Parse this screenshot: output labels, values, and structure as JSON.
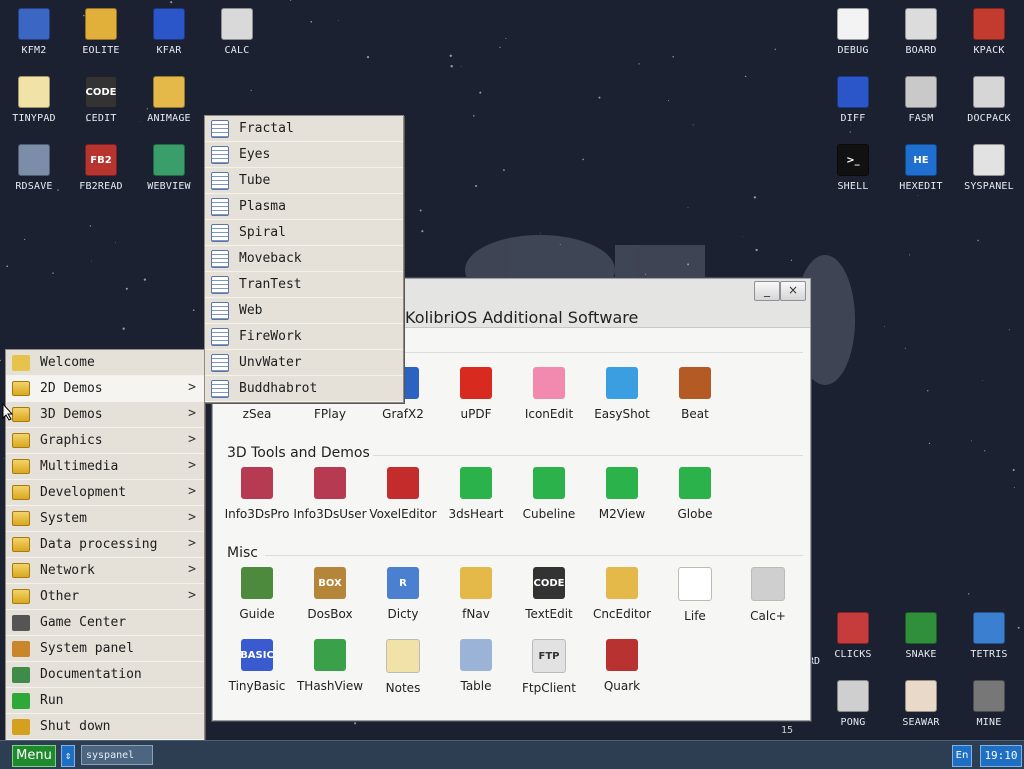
{
  "desktop": {
    "left_icons": [
      {
        "label": "KFM2",
        "color": "#3b66c4",
        "glyph": "floppy-icon"
      },
      {
        "label": "EOLITE",
        "color": "#e0b03a",
        "glyph": "folder-icon"
      },
      {
        "label": "KFAR",
        "color": "#2a56c9",
        "glyph": "kfar-icon"
      },
      {
        "label": "CALC",
        "color": "#d9d9d9",
        "glyph": "calculator-icon"
      },
      {
        "label": "TINYPAD",
        "color": "#f1e2a8",
        "glyph": "notepad-icon"
      },
      {
        "label": "CEDIT",
        "color": "#333333",
        "glyph": "code-icon",
        "text": "CODE"
      },
      {
        "label": "ANIMAGE",
        "color": "#e5b84a",
        "glyph": "pencil-icon"
      },
      {
        "label": "RDSAVE",
        "color": "#7b8da8",
        "glyph": "disk-save-icon"
      },
      {
        "label": "FB2READ",
        "color": "#b8342e",
        "glyph": "book-icon",
        "text": "FB2"
      },
      {
        "label": "WEBVIEW",
        "color": "#3a9e6a",
        "glyph": "globe-map-icon"
      }
    ],
    "right_icons": [
      {
        "label": "DEBUG",
        "color": "#f3f3f3",
        "glyph": "bug-icon"
      },
      {
        "label": "BOARD",
        "color": "#dcdcdc",
        "glyph": "board-icon"
      },
      {
        "label": "KPACK",
        "color": "#c33a2e",
        "glyph": "hammer-icon"
      },
      {
        "label": "DIFF",
        "color": "#2a56c9",
        "glyph": "diff-icon"
      },
      {
        "label": "FASM",
        "color": "#c9c9c9",
        "glyph": "anvil-icon"
      },
      {
        "label": "DOCPACK",
        "color": "#d6d6d6",
        "glyph": "cabinet-icon"
      },
      {
        "label": "SHELL",
        "color": "#111111",
        "glyph": "terminal-icon",
        "text": ">_"
      },
      {
        "label": "HEXEDIT",
        "color": "#1e6fd0",
        "glyph": "hex-icon",
        "text": "HE"
      },
      {
        "label": "SYSPANEL",
        "color": "#e2e2e2",
        "glyph": "sliders-icon"
      }
    ],
    "games_icons": [
      {
        "label": "CLICKS",
        "color": "#c63c3c",
        "glyph": "blocks-icon"
      },
      {
        "label": "SNAKE",
        "color": "#2f8f3a",
        "glyph": "snake-icon"
      },
      {
        "label": "TETRIS",
        "color": "#3b7fd0",
        "glyph": "tetris-icon"
      },
      {
        "label": "PONG",
        "color": "#cfcfcf",
        "glyph": "pong-icon"
      },
      {
        "label": "SEAWAR",
        "color": "#e9d9c9",
        "glyph": "ship-icon"
      },
      {
        "label": "MINE",
        "color": "#777777",
        "glyph": "mine-icon"
      }
    ],
    "partial_label": "RD",
    "partial_number": "15"
  },
  "window": {
    "title": "KolibriOS Additional Software",
    "minimize": "_",
    "close": "×",
    "row1": [
      {
        "label": "zSea",
        "color": "#6b8fd4"
      },
      {
        "label": "FPlay",
        "color": "#3a7ad0"
      },
      {
        "label": "GrafX2",
        "color": "#2c62c2"
      },
      {
        "label": "uPDF",
        "color": "#d92a1f"
      },
      {
        "label": "IconEdit",
        "color": "#f28ab0"
      },
      {
        "label": "EasyShot",
        "color": "#3a9ee0"
      },
      {
        "label": "Beat",
        "color": "#b35a25"
      }
    ],
    "section_3d": "3D Tools and Demos",
    "row3d": [
      {
        "label": "Info3DsPro",
        "color": "#b53a52"
      },
      {
        "label": "Info3DsUser",
        "color": "#b53a52"
      },
      {
        "label": "VoxelEditor",
        "color": "#c42c2c"
      },
      {
        "label": "3dsHeart",
        "color": "#2cb24a"
      },
      {
        "label": "Cubeline",
        "color": "#2cb24a"
      },
      {
        "label": "M2View",
        "color": "#2cb24a"
      },
      {
        "label": "Globe",
        "color": "#2cb24a"
      }
    ],
    "section_misc": "Misc",
    "rowmisc1": [
      {
        "label": "Guide",
        "color": "#4d8a3e"
      },
      {
        "label": "DosBox",
        "color": "#b5853a",
        "text": "BOX"
      },
      {
        "label": "Dicty",
        "color": "#4b7fd0",
        "text": "R"
      },
      {
        "label": "fNav",
        "color": "#e5b84a"
      },
      {
        "label": "TextEdit",
        "color": "#333333",
        "text": "CODE"
      },
      {
        "label": "CncEditor",
        "color": "#e5b84a"
      },
      {
        "label": "Life",
        "color": "#ffffff"
      },
      {
        "label": "Calc+",
        "color": "#cfcfcf"
      }
    ],
    "rowmisc2": [
      {
        "label": "TinyBasic",
        "color": "#3a5ad0",
        "text": "BASIC"
      },
      {
        "label": "THashView",
        "color": "#3aa04a"
      },
      {
        "label": "Notes",
        "color": "#f1e2a8"
      },
      {
        "label": "Table",
        "color": "#9ab3d6"
      },
      {
        "label": "FtpClient",
        "color": "#e2e2e2",
        "text": "FTP"
      },
      {
        "label": "Quark",
        "color": "#b83232"
      }
    ]
  },
  "main_menu": [
    {
      "label": "Welcome",
      "kind": "welcome-icon",
      "color": "#e6c34a"
    },
    {
      "label": "2D Demos",
      "kind": "folder",
      "arrow": ">",
      "selected": true
    },
    {
      "label": "3D Demos",
      "kind": "folder",
      "arrow": ">"
    },
    {
      "label": "Graphics",
      "kind": "folder",
      "arrow": ">"
    },
    {
      "label": "Multimedia",
      "kind": "folder",
      "arrow": ">"
    },
    {
      "label": "Development",
      "kind": "folder",
      "arrow": ">"
    },
    {
      "label": "System",
      "kind": "folder",
      "arrow": ">"
    },
    {
      "label": "Data processing",
      "kind": "folder",
      "arrow": ">"
    },
    {
      "label": "Network",
      "kind": "folder",
      "arrow": ">"
    },
    {
      "label": "Other",
      "kind": "folder",
      "arrow": ">"
    },
    {
      "label": "Game Center",
      "kind": "gamepad-icon",
      "color": "#555555"
    },
    {
      "label": "System panel",
      "kind": "gears-icon",
      "color": "#c9862b"
    },
    {
      "label": "Documentation",
      "kind": "books-icon",
      "color": "#3f8c4a"
    },
    {
      "label": "Run",
      "kind": "play-icon",
      "color": "#2fa83a"
    },
    {
      "label": "Shut down",
      "kind": "key-icon",
      "color": "#d4a020"
    }
  ],
  "submenu_2d": [
    "Fractal",
    "Eyes",
    "Tube",
    "Plasma",
    "Spiral",
    "Moveback",
    "TranTest",
    "Web",
    "FireWork",
    "UnvWater",
    "Buddhabrot"
  ],
  "taskbar": {
    "menu_label": "Menu",
    "switch_label": "⇕",
    "task_item": "syspanel",
    "lang": "En",
    "clock": "19:10"
  }
}
